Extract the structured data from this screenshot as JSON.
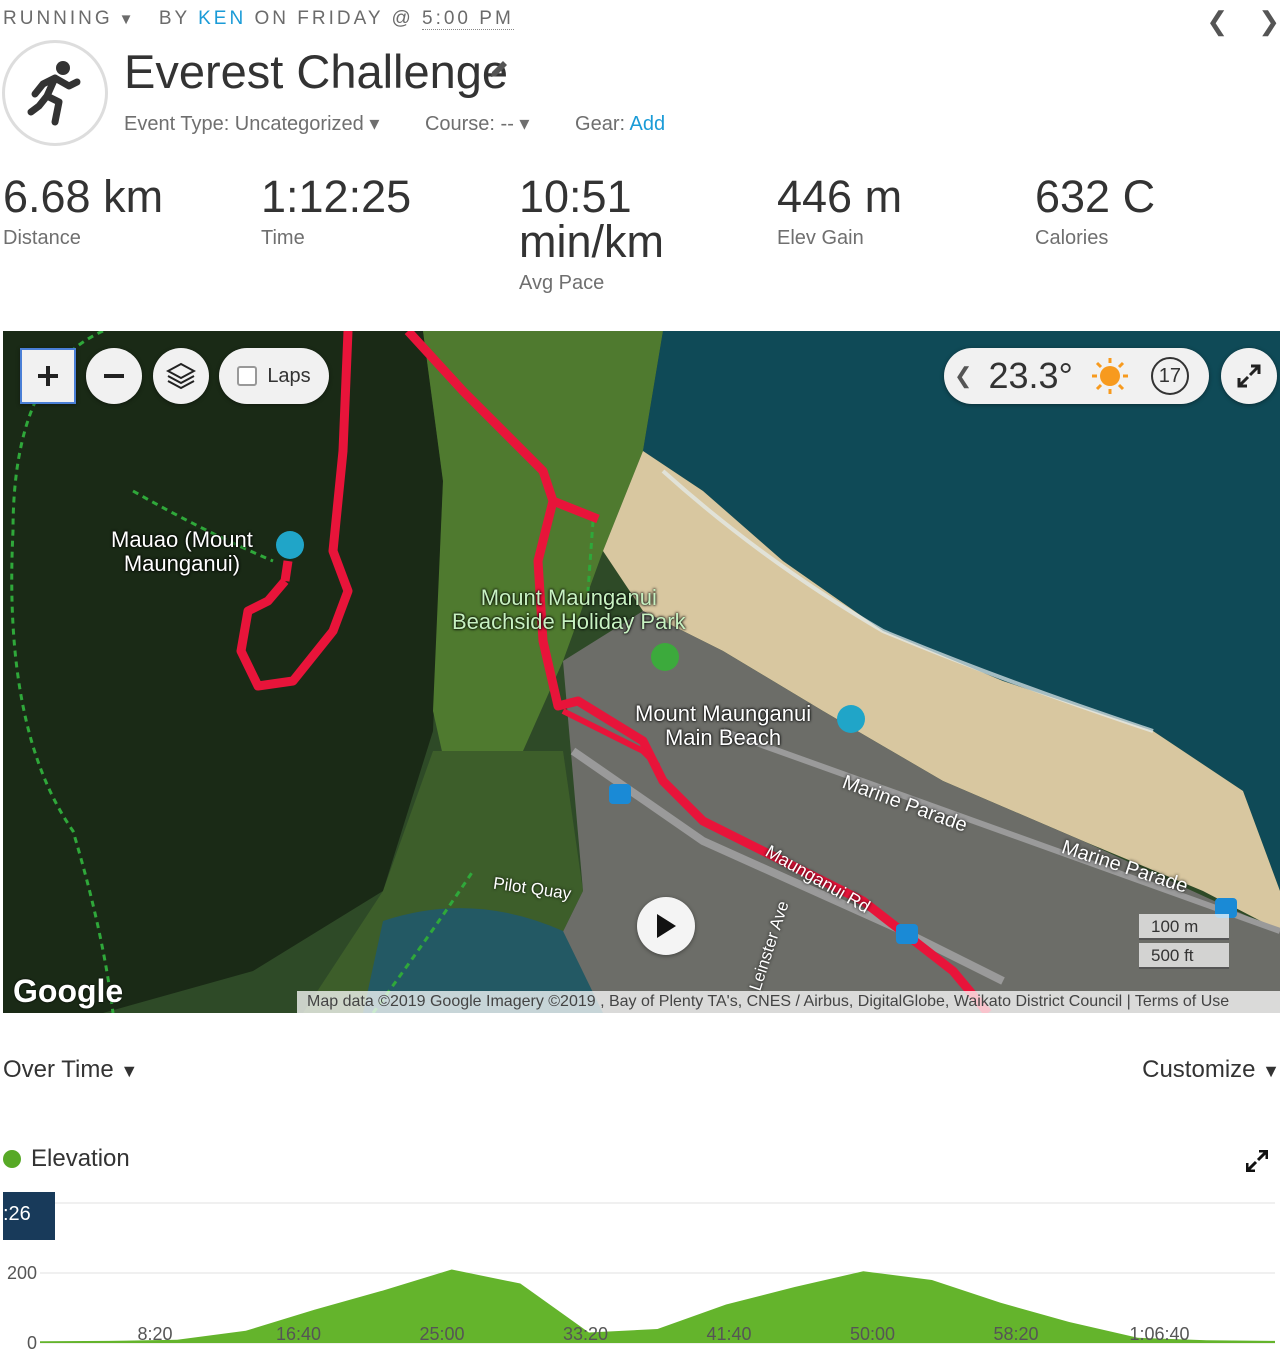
{
  "header": {
    "activity_type": "RUNNING",
    "by_label": "BY",
    "user": "KEN",
    "on_label": "ON FRIDAY @",
    "time": "5:00 PM",
    "title": "Everest Challenge",
    "event_type_label": "Event Type: Uncategorized",
    "course_label": "Course: --",
    "gear_label": "Gear:",
    "gear_link": "Add"
  },
  "stats": [
    {
      "value": "6.68 km",
      "label": "Distance"
    },
    {
      "value": "1:12:25",
      "label": "Time"
    },
    {
      "value": "10:51",
      "value2": "min/km",
      "label": "Avg Pace"
    },
    {
      "value": "446 m",
      "label": "Elev Gain"
    },
    {
      "value": "632 C",
      "label": "Calories"
    }
  ],
  "map": {
    "laps_label": "Laps",
    "temperature": "23.3°",
    "wind_speed": "17",
    "labels": {
      "mauao_1": "Mauao (Mount",
      "mauao_2": "Maunganui)",
      "park_1": "Mount Maunganui",
      "park_2": "Beachside Holiday Park",
      "beach_1": "Mount Maunganui",
      "beach_2": "Main Beach",
      "marine1": "Marine Parade",
      "marine2": "Marine Parade",
      "pilot": "Pilot Quay",
      "maunganui_rd": "Maunganui Rd",
      "leinster": "Leinster Ave"
    },
    "google": "Google",
    "attribution": "Map data ©2019 Google Imagery ©2019 , Bay of Plenty TA's, CNES / Airbus, DigitalGlobe, Waikato District Council  |  Terms of Use",
    "scale_m": "100 m",
    "scale_ft": "500 ft",
    "colors": {
      "route": "#e8143a",
      "trail": "#2fa83a"
    }
  },
  "chart_header": {
    "over_time": "Over Time",
    "customize": "Customize",
    "legend": "Elevation",
    "tooltip": ":26"
  },
  "chart_data": {
    "type": "area",
    "series": [
      {
        "name": "Elevation",
        "color": "#64b42c",
        "x": [
          "0:00",
          "4:10",
          "8:20",
          "12:30",
          "16:40",
          "20:50",
          "25:00",
          "29:10",
          "33:20",
          "37:30",
          "41:40",
          "45:50",
          "50:00",
          "54:10",
          "58:20",
          "1:02:30",
          "1:06:40",
          "1:10:50",
          "1:12:25"
        ],
        "values": [
          5,
          6,
          9,
          35,
          95,
          150,
          210,
          170,
          30,
          40,
          110,
          160,
          205,
          180,
          115,
          60,
          15,
          8,
          6
        ]
      }
    ],
    "ylim": [
      0,
      400
    ],
    "yticks": [
      "0",
      "200",
      "400"
    ],
    "xticks": [
      "8:20",
      "16:40",
      "25:00",
      "33:20",
      "41:40",
      "50:00",
      "58:20",
      "1:06:40"
    ]
  }
}
